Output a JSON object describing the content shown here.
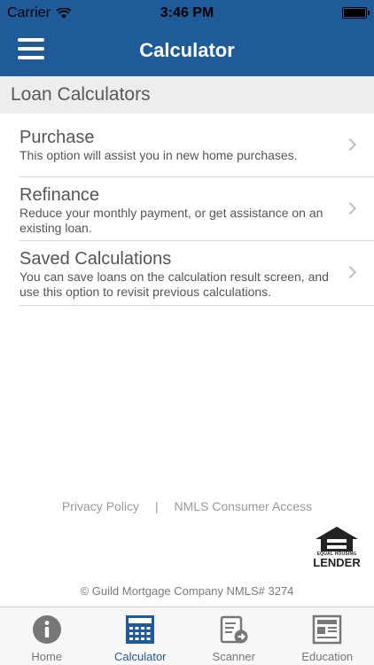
{
  "status_bar": {
    "carrier": "Carrier",
    "time": "3:46 PM"
  },
  "nav": {
    "title": "Calculator"
  },
  "section": {
    "title": "Loan Calculators"
  },
  "items": [
    {
      "title": "Purchase",
      "description": "This option will assist you in new home purchases."
    },
    {
      "title": "Refinance",
      "description": "Reduce your monthly payment, or get assistance on an existing loan."
    },
    {
      "title": "Saved Calculations",
      "description": "You can save loans on the calculation result screen, and use this option to revisit previous calculations."
    }
  ],
  "footer": {
    "privacy": "Privacy Policy",
    "separator": "|",
    "nmls_access": "NMLS Consumer Access",
    "ehl_small": "EQUAL HOUSING",
    "ehl_big": "LENDER",
    "copyright": "© Guild Mortgage Company NMLS# 3274"
  },
  "tabs": [
    {
      "label": "Home",
      "icon": "info-icon",
      "active": false
    },
    {
      "label": "Calculator",
      "icon": "calculator-icon",
      "active": true
    },
    {
      "label": "Scanner",
      "icon": "scanner-icon",
      "active": false
    },
    {
      "label": "Education",
      "icon": "newspaper-icon",
      "active": false
    }
  ],
  "colors": {
    "primary": "#1f5b98",
    "header_bg": "#ededed",
    "tab_inactive": "#777777"
  }
}
